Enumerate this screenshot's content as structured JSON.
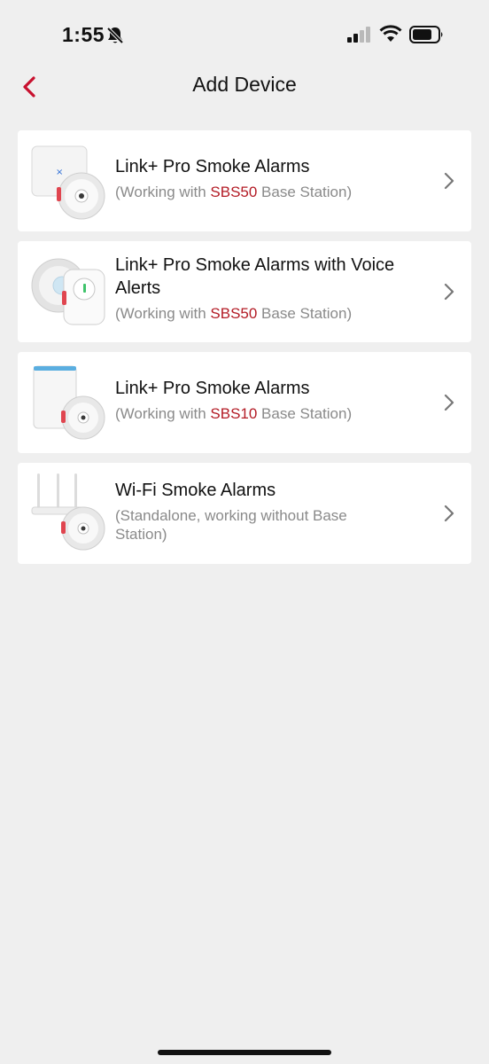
{
  "status_bar": {
    "time": "1:55"
  },
  "header": {
    "title": "Add Device"
  },
  "devices": [
    {
      "name": "Link+ Pro Smoke Alarms",
      "sub_prefix": "(Working with ",
      "sub_highlight": "SBS50",
      "sub_suffix": " Base Station)"
    },
    {
      "name": "Link+ Pro Smoke Alarms with Voice Alerts",
      "sub_prefix": "(Working with ",
      "sub_highlight": "SBS50",
      "sub_suffix": " Base Station)"
    },
    {
      "name": "Link+ Pro Smoke Alarms",
      "sub_prefix": "(Working with ",
      "sub_highlight": "SBS10",
      "sub_suffix": " Base Station)"
    },
    {
      "name": "Wi-Fi Smoke Alarms",
      "sub_text": "(Standalone, working without Base Station)"
    }
  ],
  "colors": {
    "accent": "#c8102e",
    "highlight": "#b31b25",
    "background": "#efefef"
  }
}
